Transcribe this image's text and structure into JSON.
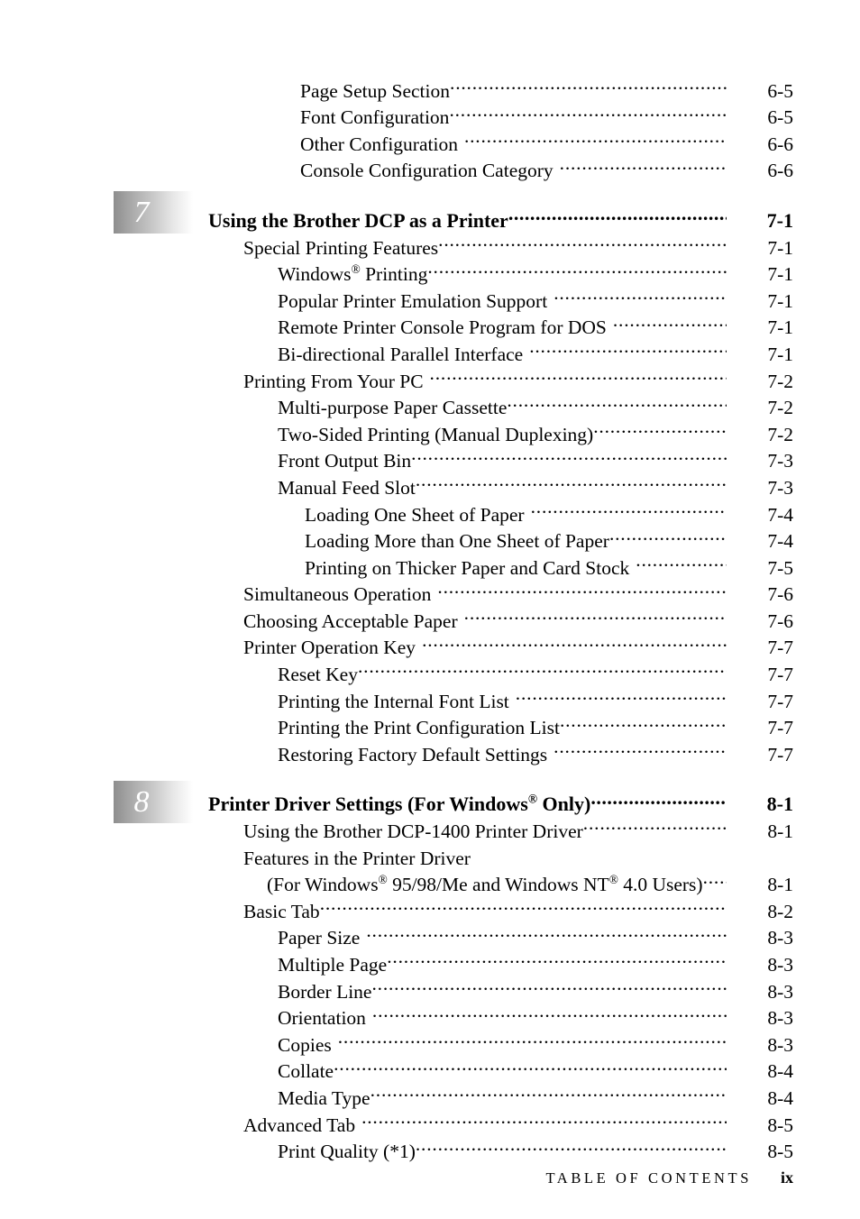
{
  "document": {
    "type": "table-of-contents",
    "footer_label": "T A B L E   O F   C O N T E N T S",
    "footer_label_plain": "TABLE OF CONTENTS",
    "page_number": "ix"
  },
  "rows": [
    {
      "level": 2,
      "title": "Page Setup Section",
      "page": "6-5"
    },
    {
      "level": 2,
      "title": "Font Configuration",
      "page": "6-5"
    },
    {
      "level": 2,
      "title": "Other Configuration",
      "page": "6-6"
    },
    {
      "level": 2,
      "title": "Console Configuration Category",
      "page": "6-6"
    },
    {
      "level": 0,
      "chapter": "7",
      "title": "Using the Brother DCP as a Printer",
      "page": "7-1"
    },
    {
      "level": 1,
      "title": "Special Printing Features",
      "page": "7-1"
    },
    {
      "level": 2,
      "title": "Windows® Printing",
      "title_main": "Windows",
      "title_sup": "®",
      "title_rest": " Printing",
      "page": "7-1"
    },
    {
      "level": 2,
      "title": "Popular Printer Emulation Support",
      "page": "7-1"
    },
    {
      "level": 2,
      "title": "Remote Printer Console Program for DOS",
      "page": "7-1"
    },
    {
      "level": 2,
      "title": "Bi-directional Parallel Interface",
      "page": "7-1"
    },
    {
      "level": 1,
      "title": "Printing From Your PC",
      "page": "7-2"
    },
    {
      "level": 2,
      "title": "Multi-purpose Paper Cassette",
      "page": "7-2"
    },
    {
      "level": 2,
      "title": "Two-Sided Printing (Manual Duplexing)",
      "page": "7-2"
    },
    {
      "level": 2,
      "title": "Front Output Bin",
      "page": "7-3"
    },
    {
      "level": 2,
      "title": "Manual Feed Slot",
      "page": "7-3"
    },
    {
      "level": 3,
      "title": "Loading One Sheet of Paper",
      "page": "7-4"
    },
    {
      "level": 3,
      "title": "Loading More than One Sheet of Paper",
      "page": "7-4"
    },
    {
      "level": 3,
      "title": "Printing on Thicker Paper and Card Stock",
      "page": "7-5"
    },
    {
      "level": 1,
      "title": "Simultaneous Operation",
      "page": "7-6"
    },
    {
      "level": 1,
      "title": "Choosing Acceptable Paper",
      "page": "7-6"
    },
    {
      "level": 1,
      "title": "Printer Operation Key",
      "page": "7-7"
    },
    {
      "level": 2,
      "title": "Reset Key",
      "page": "7-7"
    },
    {
      "level": 2,
      "title": "Printing the Internal Font List",
      "page": "7-7"
    },
    {
      "level": 2,
      "title": "Printing the Print Configuration List",
      "page": "7-7"
    },
    {
      "level": 2,
      "title": "Restoring Factory Default Settings",
      "page": "7-7"
    },
    {
      "level": 0,
      "chapter": "8",
      "title": "Printer Driver Settings (For Windows® Only)",
      "page": "8-1"
    },
    {
      "level": 1,
      "title": "Using the Brother DCP-1400 Printer Driver",
      "page": "8-1"
    },
    {
      "level": 1,
      "title": "Features in the Printer Driver",
      "page": ""
    },
    {
      "level": 1,
      "title": "(For Windows® 95/98/Me and Windows NT® 4.0 Users)",
      "page": "8-1",
      "continuation": true
    },
    {
      "level": 1,
      "title": "Basic Tab",
      "page": "8-2"
    },
    {
      "level": 2,
      "title": "Paper Size",
      "page": "8-3"
    },
    {
      "level": 2,
      "title": "Multiple Page",
      "page": "8-3"
    },
    {
      "level": 2,
      "title": "Border Line",
      "page": "8-3"
    },
    {
      "level": 2,
      "title": "Orientation",
      "page": "8-3"
    },
    {
      "level": 2,
      "title": "Copies",
      "page": "8-3"
    },
    {
      "level": 2,
      "title": "Collate",
      "page": "8-4"
    },
    {
      "level": 2,
      "title": "Media Type",
      "page": "8-4"
    },
    {
      "level": 1,
      "title": "Advanced Tab",
      "page": "8-5"
    },
    {
      "level": 2,
      "title": "Print Quality (*1)",
      "page": "8-5"
    }
  ],
  "labels": {
    "r0_title": "Page Setup Section",
    "r0_page": "6-5",
    "r1_title": "Font Configuration",
    "r1_page": "6-5",
    "r2_title": "Other Configuration",
    "r2_page": "6-6",
    "r3_title": "Console Configuration Category",
    "r3_page": "6-6",
    "ch7_num": "7",
    "ch7_title": "Using the Brother DCP as a Printer",
    "ch7_page": "7-1",
    "r4_title": "Special Printing Features",
    "r4_page": "7-1",
    "r5_title_main": "Windows",
    "r5_title_sup": "®",
    "r5_title_rest": " Printing",
    "r5_page": "7-1",
    "r6_title": "Popular Printer Emulation Support",
    "r6_page": "7-1",
    "r7_title": "Remote Printer Console Program for DOS",
    "r7_page": "7-1",
    "r8_title": "Bi-directional Parallel Interface",
    "r8_page": "7-1",
    "r9_title": "Printing From Your PC",
    "r9_page": "7-2",
    "r10_title": "Multi-purpose Paper Cassette",
    "r10_page": "7-2",
    "r11_title": "Two-Sided Printing (Manual Duplexing)",
    "r11_page": "7-2",
    "r12_title": "Front Output Bin",
    "r12_page": "7-3",
    "r13_title": "Manual Feed Slot",
    "r13_page": "7-3",
    "r14_title": "Loading One Sheet of Paper",
    "r14_page": "7-4",
    "r15_title": "Loading More than One Sheet of Paper",
    "r15_page": "7-4",
    "r16_title": "Printing on Thicker Paper and Card Stock",
    "r16_page": "7-5",
    "r17_title": "Simultaneous Operation",
    "r17_page": "7-6",
    "r18_title": "Choosing Acceptable Paper",
    "r18_page": "7-6",
    "r19_title": "Printer Operation Key",
    "r19_page": "7-7",
    "r20_title": "Reset Key",
    "r20_page": "7-7",
    "r21_title": "Printing the Internal Font List",
    "r21_page": "7-7",
    "r22_title": "Printing the Print Configuration List",
    "r22_page": "7-7",
    "r23_title": "Restoring Factory Default Settings",
    "r23_page": "7-7",
    "ch8_num": "8",
    "ch8_title_a": "Printer Driver Settings (For Windows",
    "ch8_title_sup": "®",
    "ch8_title_b": " Only)",
    "ch8_page": "8-1",
    "r24_title": "Using the Brother DCP-1400 Printer Driver",
    "r24_page": "8-1",
    "r25_title": "Features in the Printer Driver",
    "r26_a": "(For Windows",
    "r26_sup1": "®",
    "r26_b": " 95/98/Me and Windows NT",
    "r26_sup2": "®",
    "r26_c": " 4.0 Users)",
    "r26_page": "8-1",
    "r27_title": "Basic Tab",
    "r27_page": "8-2",
    "r28_title": "Paper Size",
    "r28_page": "8-3",
    "r29_title": "Multiple Page",
    "r29_page": "8-3",
    "r30_title": "Border Line",
    "r30_page": "8-3",
    "r31_title": "Orientation",
    "r31_page": "8-3",
    "r32_title": "Copies",
    "r32_page": "8-3",
    "r33_title": "Collate",
    "r33_page": "8-4",
    "r34_title": "Media Type",
    "r34_page": "8-4",
    "r35_title": "Advanced Tab",
    "r35_page": "8-5",
    "r36_title": "Print Quality (*1)",
    "r36_page": "8-5"
  }
}
